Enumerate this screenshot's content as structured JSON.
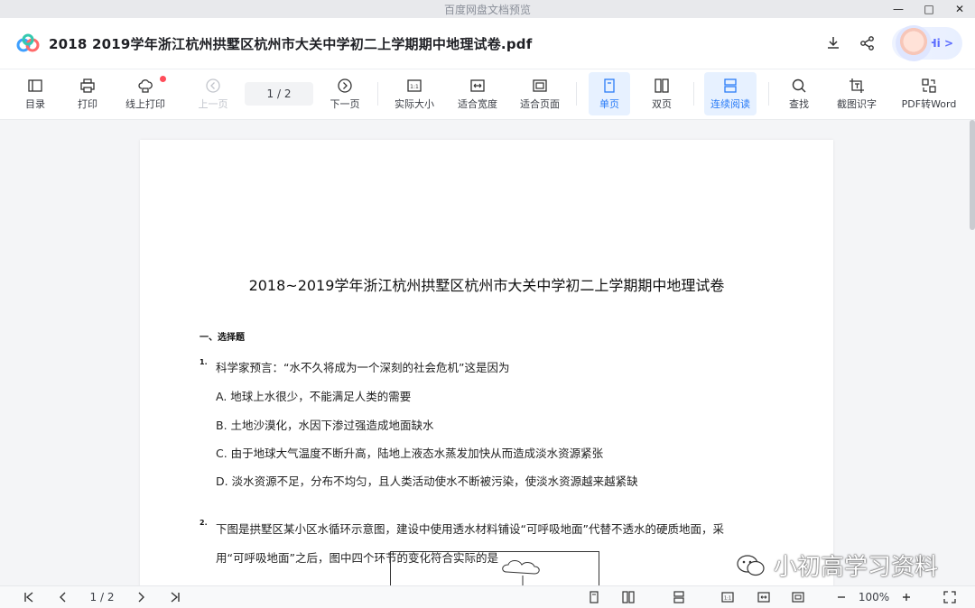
{
  "window": {
    "title": "百度网盘文档预览"
  },
  "header": {
    "doc_title": "2018  2019学年浙江杭州拱墅区杭州市大关中学初二上学期期中地理试卷.pdf",
    "hi_label": "Hi >"
  },
  "toolbar": {
    "toc": "目录",
    "print": "打印",
    "online_print": "线上打印",
    "prev": "上一页",
    "page_indicator": "1  /  2",
    "next": "下一页",
    "actual_size": "实际大小",
    "fit_width": "适合宽度",
    "fit_page": "适合页面",
    "single": "单页",
    "double": "双页",
    "continuous": "连续阅读",
    "find": "查找",
    "ocr": "截图识字",
    "to_word": "PDF转Word"
  },
  "document": {
    "title": "2018~2019学年浙江杭州拱墅区杭州市大关中学初二上学期期中地理试卷",
    "section": "一、选择题",
    "q1": {
      "num": "1.",
      "stem": "科学家预言：“水不久将成为一个深刻的社会危机”这是因为",
      "options": [
        "A. 地球上水很少，不能满足人类的需要",
        "B. 土地沙漠化，水因下渗过强造成地面缺水",
        "C. 由于地球大气温度不断升高，陆地上液态水蒸发加快从而造成淡水资源紧张",
        "D. 淡水资源不足，分布不均匀，且人类活动使水不断被污染，使淡水资源越来越紧缺"
      ]
    },
    "q2": {
      "num": "2.",
      "line1": "下图是拱墅区某小区水循环示意图，建设中使用透水材料铺设“可呼吸地面”代替不透水的硬质地面，采",
      "line2": "用“可呼吸地面”之后，图中四个环节的变化符合实际的是"
    }
  },
  "watermark": {
    "text": "小初高学习资料"
  },
  "statusbar": {
    "page_indicator": "1 / 2",
    "zoom": "100%"
  },
  "colors": {
    "accent": "#2a7cf7",
    "active_bg": "#e7f1ff",
    "badge_dot": "#ff4d5a"
  }
}
